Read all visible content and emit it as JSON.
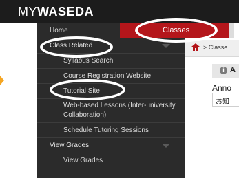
{
  "app": {
    "brand_prefix": "MY",
    "brand_name": "WASEDA"
  },
  "tabs": [
    {
      "label": "Home"
    },
    {
      "label": "Classes"
    }
  ],
  "sidebar": {
    "items": [
      {
        "label": "Class Related"
      },
      {
        "label": "Syllabus Search"
      },
      {
        "label": "Course Registration Website"
      },
      {
        "label": "Tutorial Site"
      },
      {
        "label": "Web-based Lessons (Inter-university Collaboration)"
      },
      {
        "label": "Schedule Tutoring Sessions"
      },
      {
        "label": "View Grades"
      },
      {
        "label": "View Grades"
      }
    ]
  },
  "breadcrumb": {
    "text": "> Classe"
  },
  "info_bar": {
    "icon_letter": "i",
    "text": "A"
  },
  "announcements": {
    "label": "Anno",
    "box_text": "お知"
  },
  "colors": {
    "accent": "#b4161b",
    "sidebar": "#2b2b2b",
    "topbar": "#1c1c1c",
    "highlight_ring": "#ffffff",
    "pointer": "#f5a623"
  }
}
